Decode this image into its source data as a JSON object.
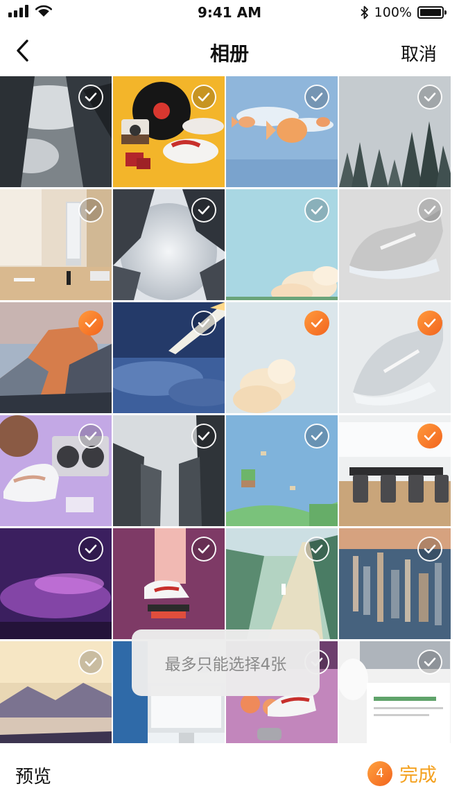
{
  "status_bar": {
    "time": "9:41 AM",
    "battery_text": "100%",
    "icons": [
      "signal-icon",
      "wifi-icon",
      "bluetooth-icon",
      "battery-icon"
    ]
  },
  "nav": {
    "title": "相册",
    "back_icon": "chevron-left-icon",
    "cancel_label": "取消"
  },
  "grid": {
    "columns": 4,
    "photos": [
      {
        "subject": "skyscrapers-clouds-bw",
        "selected": false
      },
      {
        "subject": "vinyl-camera-sneakers-yellow",
        "selected": false
      },
      {
        "subject": "goldfish-sky",
        "selected": false
      },
      {
        "subject": "foggy-pine-forest",
        "selected": false
      },
      {
        "subject": "desk-imac",
        "selected": false
      },
      {
        "subject": "skyscrapers-fog-up",
        "selected": false
      },
      {
        "subject": "pastel-clouds-bottom",
        "selected": false
      },
      {
        "subject": "grey-running-shoe",
        "selected": false
      },
      {
        "subject": "yosemite-half-dome",
        "selected": true
      },
      {
        "subject": "comet-over-clouds",
        "selected": false
      },
      {
        "subject": "pastel-clouds-tall",
        "selected": true
      },
      {
        "subject": "grey-running-shoe-angled",
        "selected": true
      },
      {
        "subject": "basketball-boombox-sneakers",
        "selected": false
      },
      {
        "subject": "city-towers-mist",
        "selected": false
      },
      {
        "subject": "floating-islands",
        "selected": false
      },
      {
        "subject": "conference-room",
        "selected": true
      },
      {
        "subject": "purple-aurora",
        "selected": false
      },
      {
        "subject": "sneakers-skateboard",
        "selected": false
      },
      {
        "subject": "tree-lined-path",
        "selected": false
      },
      {
        "subject": "city-aerial-dusk",
        "selected": false
      },
      {
        "subject": "lake-mountains-sunset",
        "selected": false
      },
      {
        "subject": "person-at-imac",
        "selected": false
      },
      {
        "subject": "sneaker-game-controller",
        "selected": false
      },
      {
        "subject": "laptop-mug-notebook",
        "selected": false
      }
    ]
  },
  "toast": {
    "message": "最多只能选择4张"
  },
  "bottom_bar": {
    "preview_label": "预览",
    "selected_count": "4",
    "done_label": "完成"
  },
  "colors": {
    "accent": "#F2641E",
    "done_text": "#F4A11F"
  }
}
